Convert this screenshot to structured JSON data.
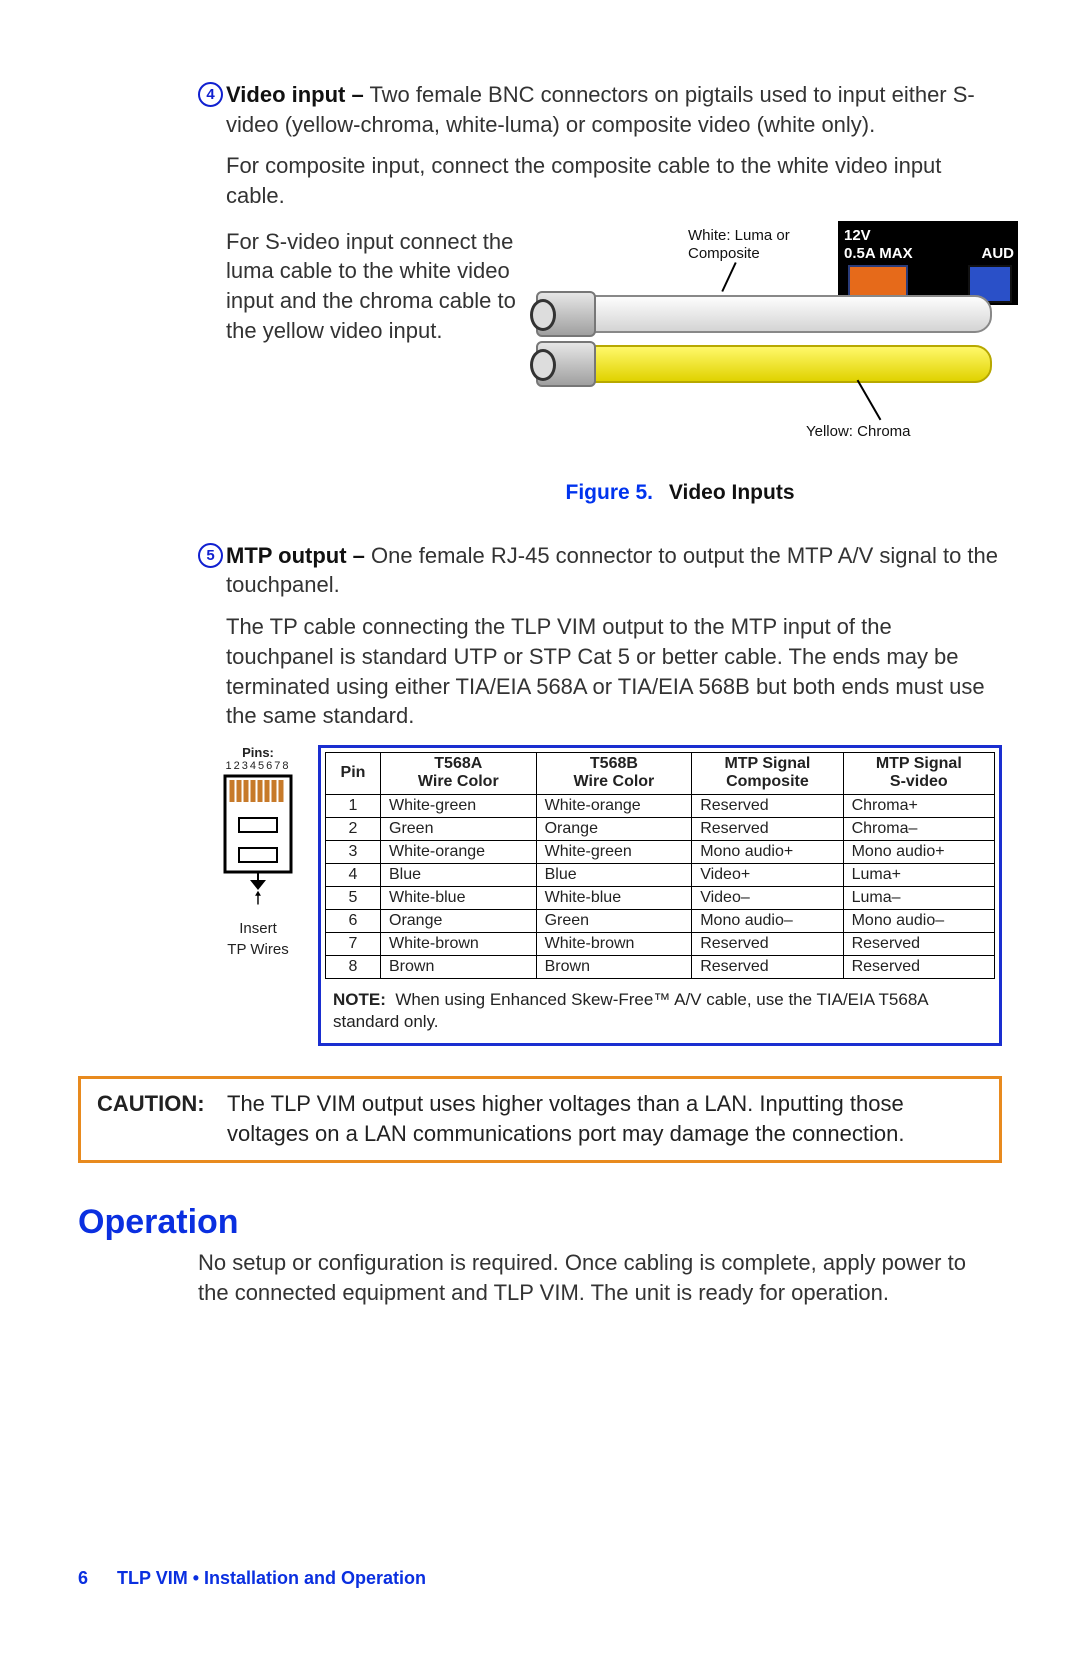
{
  "item4": {
    "num": "4",
    "title": "Video input –",
    "desc": "Two female BNC connectors on pigtails used to input either S-video (yellow-chroma, white-luma) or composite video (white only).",
    "p2": "For composite input, connect the composite cable to the white video input cable.",
    "p3": "For S-video input connect the luma cable to the white video input and the chroma cable to the yellow video input."
  },
  "fig5": {
    "label": "Figure 5.",
    "title": "Video Inputs",
    "whiteLabel": "White: Luma or\nComposite",
    "yellowLabel": "Yellow:  Chroma",
    "panel_12v": "12V",
    "panel_05a": "0.5A MAX",
    "panel_aud": "AUD"
  },
  "item5": {
    "num": "5",
    "title": "MTP output –",
    "desc": "One female RJ-45 connector to output the MTP A/V signal to the touchpanel.",
    "p2": "The TP cable connecting the TLP VIM output to the MTP input of the touchpanel is standard UTP or STP Cat 5 or better cable. The ends may be terminated using either TIA/EIA 568A or TIA/EIA 568B but both ends must use the same standard."
  },
  "rj45": {
    "pinsLabel": "Pins:",
    "pinsNums": "12345678",
    "insert1": "Insert",
    "insert2": "TP Wires"
  },
  "pinTable": {
    "headers": {
      "pin": "Pin",
      "t568a": "T568A\nWire Color",
      "t568b": "T568B\nWire Color",
      "mtpc": "MTP Signal\nComposite",
      "mtps": "MTP Signal\nS-video"
    },
    "rows": [
      {
        "pin": "1",
        "a": "White-green",
        "b": "White-orange",
        "c": "Reserved",
        "s": "Chroma+"
      },
      {
        "pin": "2",
        "a": "Green",
        "b": "Orange",
        "c": "Reserved",
        "s": "Chroma–"
      },
      {
        "pin": "3",
        "a": "White-orange",
        "b": "White-green",
        "c": "Mono audio+",
        "s": "Mono audio+"
      },
      {
        "pin": "4",
        "a": "Blue",
        "b": "Blue",
        "c": "Video+",
        "s": "Luma+"
      },
      {
        "pin": "5",
        "a": "White-blue",
        "b": "White-blue",
        "c": "Video–",
        "s": "Luma–"
      },
      {
        "pin": "6",
        "a": "Orange",
        "b": "Green",
        "c": "Mono audio–",
        "s": "Mono audio–"
      },
      {
        "pin": "7",
        "a": "White-brown",
        "b": "White-brown",
        "c": "Reserved",
        "s": "Reserved"
      },
      {
        "pin": "8",
        "a": "Brown",
        "b": "Brown",
        "c": "Reserved",
        "s": "Reserved"
      }
    ],
    "noteLabel": "NOTE:",
    "noteText": "When using Enhanced Skew-Free™ A/V cable, use the TIA/EIA T568A standard only."
  },
  "caution": {
    "label": "CAUTION:",
    "text": "The TLP VIM output uses higher voltages than a LAN.  Inputting those voltages on a LAN communications port may damage the connection."
  },
  "operation": {
    "heading": "Operation",
    "body": "No setup or configuration is required.  Once cabling is complete, apply power to the connected equipment and TLP VIM.  The unit is ready for operation."
  },
  "footer": {
    "page": "6",
    "title": "TLP VIM • Installation and Operation"
  }
}
